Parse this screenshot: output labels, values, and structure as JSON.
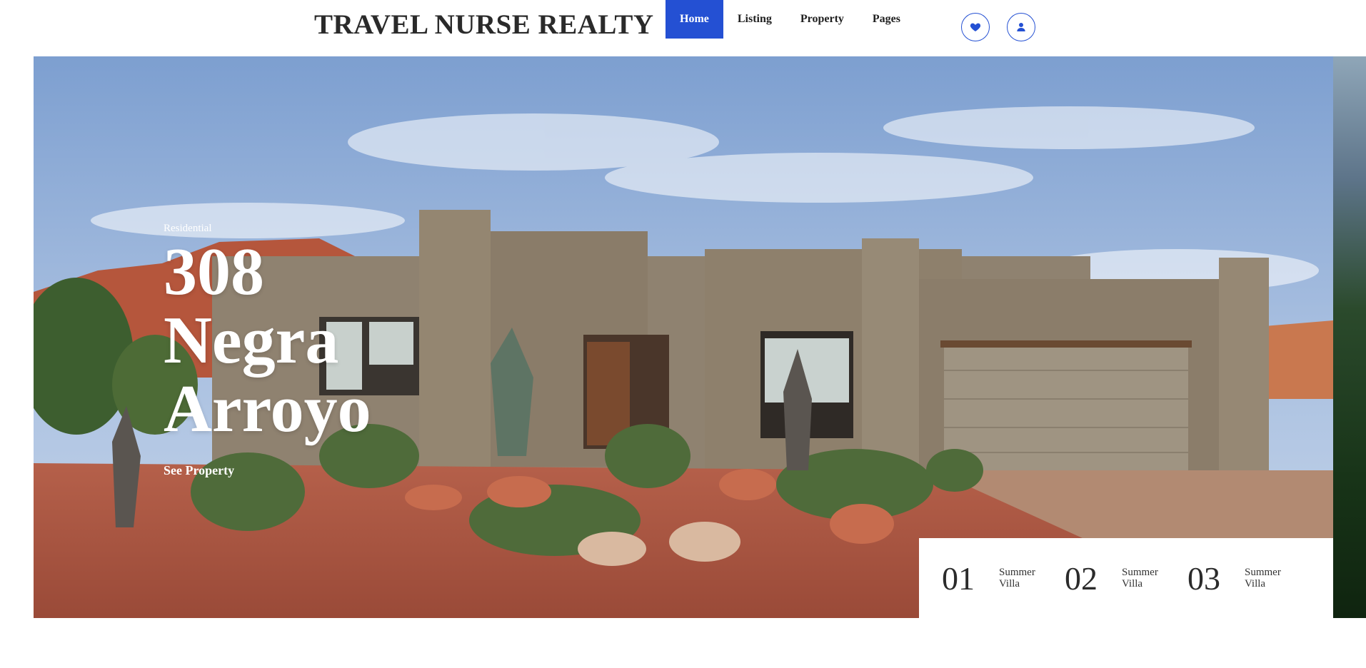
{
  "header": {
    "logo": "TRAVEL NURSE REALTY",
    "nav": [
      {
        "label": "Home",
        "active": true
      },
      {
        "label": "Listing",
        "active": false
      },
      {
        "label": "Property",
        "active": false
      },
      {
        "label": "Pages",
        "active": false
      }
    ],
    "icons": {
      "favorites": "heart-icon",
      "account": "user-icon"
    }
  },
  "hero": {
    "category": "Residential",
    "title": "308 Negra Arroyo",
    "cta": "See Property",
    "slides": [
      {
        "num": "01",
        "label": "Summer Villa"
      },
      {
        "num": "02",
        "label": "Summer Villa"
      },
      {
        "num": "03",
        "label": "Summer Villa"
      }
    ]
  },
  "colors": {
    "accent": "#2450d3",
    "text": "#2b2b2b",
    "white": "#ffffff"
  }
}
